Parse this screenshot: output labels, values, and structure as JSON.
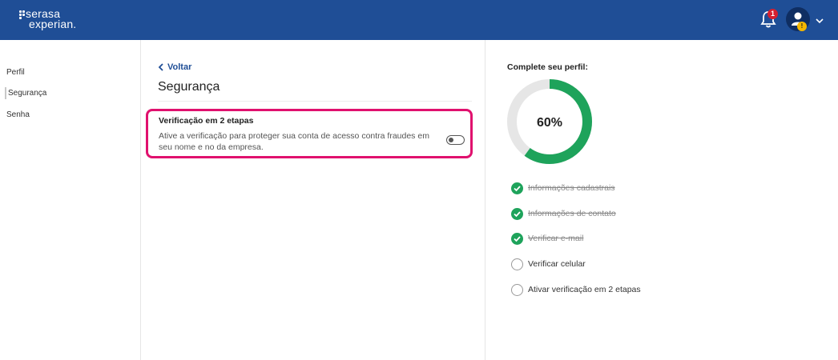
{
  "header": {
    "logo_line1": "serasa",
    "logo_line2": "experian.",
    "notifications_count": "1",
    "profile_badge": "!"
  },
  "sidebar": {
    "items": [
      {
        "label": "Perfil"
      },
      {
        "label": "Segurança"
      },
      {
        "label": "Senha"
      }
    ]
  },
  "main": {
    "back_label": "Voltar",
    "title": "Segurança",
    "card": {
      "title": "Verificação em 2 etapas",
      "description": "Ative a verificação para proteger sua conta de acesso contra fraudes em seu nome e no da empresa.",
      "toggle_on": false
    }
  },
  "profile_panel": {
    "title": "Complete seu perfil:",
    "progress_percent": 60,
    "progress_label": "60%",
    "items": [
      {
        "label": "Informações cadastrais",
        "done": true
      },
      {
        "label": "Informações de contato",
        "done": true
      },
      {
        "label": "Verificar e-mail",
        "done": true
      },
      {
        "label": "Verificar celular",
        "done": false
      },
      {
        "label": "Ativar verificação em 2 etapas",
        "done": false
      }
    ]
  },
  "colors": {
    "header_bg": "#1f4e96",
    "accent_link": "#1f4e96",
    "highlight_border": "#e0116e",
    "progress_green": "#1ea35b",
    "progress_track": "#e6e6e6",
    "badge_red": "#d6202f",
    "badge_yellow": "#f5b800"
  }
}
